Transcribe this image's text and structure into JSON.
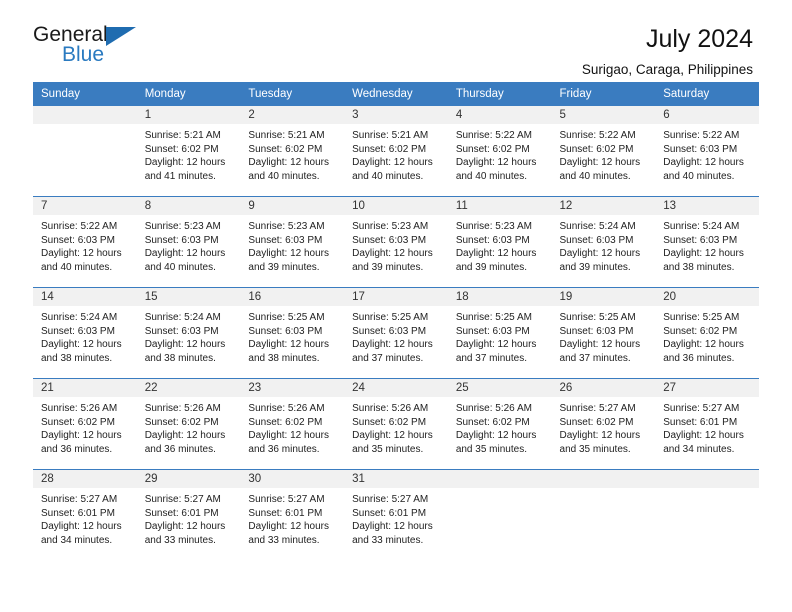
{
  "brand": {
    "name_top": "General",
    "name_bottom": "Blue",
    "triangle_color": "#1f6cb0",
    "blue_color": "#2a7ac0"
  },
  "header": {
    "title": "July 2024",
    "subtitle": "Surigao, Caraga, Philippines",
    "header_bg": "#3a7cc0",
    "daynum_bg": "#f1f1f1"
  },
  "weekdays": [
    "Sunday",
    "Monday",
    "Tuesday",
    "Wednesday",
    "Thursday",
    "Friday",
    "Saturday"
  ],
  "weeks": [
    [
      {
        "day": ""
      },
      {
        "day": "1",
        "sunrise": "Sunrise: 5:21 AM",
        "sunset": "Sunset: 6:02 PM",
        "daylight1": "Daylight: 12 hours",
        "daylight2": "and 41 minutes."
      },
      {
        "day": "2",
        "sunrise": "Sunrise: 5:21 AM",
        "sunset": "Sunset: 6:02 PM",
        "daylight1": "Daylight: 12 hours",
        "daylight2": "and 40 minutes."
      },
      {
        "day": "3",
        "sunrise": "Sunrise: 5:21 AM",
        "sunset": "Sunset: 6:02 PM",
        "daylight1": "Daylight: 12 hours",
        "daylight2": "and 40 minutes."
      },
      {
        "day": "4",
        "sunrise": "Sunrise: 5:22 AM",
        "sunset": "Sunset: 6:02 PM",
        "daylight1": "Daylight: 12 hours",
        "daylight2": "and 40 minutes."
      },
      {
        "day": "5",
        "sunrise": "Sunrise: 5:22 AM",
        "sunset": "Sunset: 6:02 PM",
        "daylight1": "Daylight: 12 hours",
        "daylight2": "and 40 minutes."
      },
      {
        "day": "6",
        "sunrise": "Sunrise: 5:22 AM",
        "sunset": "Sunset: 6:03 PM",
        "daylight1": "Daylight: 12 hours",
        "daylight2": "and 40 minutes."
      }
    ],
    [
      {
        "day": "7",
        "sunrise": "Sunrise: 5:22 AM",
        "sunset": "Sunset: 6:03 PM",
        "daylight1": "Daylight: 12 hours",
        "daylight2": "and 40 minutes."
      },
      {
        "day": "8",
        "sunrise": "Sunrise: 5:23 AM",
        "sunset": "Sunset: 6:03 PM",
        "daylight1": "Daylight: 12 hours",
        "daylight2": "and 40 minutes."
      },
      {
        "day": "9",
        "sunrise": "Sunrise: 5:23 AM",
        "sunset": "Sunset: 6:03 PM",
        "daylight1": "Daylight: 12 hours",
        "daylight2": "and 39 minutes."
      },
      {
        "day": "10",
        "sunrise": "Sunrise: 5:23 AM",
        "sunset": "Sunset: 6:03 PM",
        "daylight1": "Daylight: 12 hours",
        "daylight2": "and 39 minutes."
      },
      {
        "day": "11",
        "sunrise": "Sunrise: 5:23 AM",
        "sunset": "Sunset: 6:03 PM",
        "daylight1": "Daylight: 12 hours",
        "daylight2": "and 39 minutes."
      },
      {
        "day": "12",
        "sunrise": "Sunrise: 5:24 AM",
        "sunset": "Sunset: 6:03 PM",
        "daylight1": "Daylight: 12 hours",
        "daylight2": "and 39 minutes."
      },
      {
        "day": "13",
        "sunrise": "Sunrise: 5:24 AM",
        "sunset": "Sunset: 6:03 PM",
        "daylight1": "Daylight: 12 hours",
        "daylight2": "and 38 minutes."
      }
    ],
    [
      {
        "day": "14",
        "sunrise": "Sunrise: 5:24 AM",
        "sunset": "Sunset: 6:03 PM",
        "daylight1": "Daylight: 12 hours",
        "daylight2": "and 38 minutes."
      },
      {
        "day": "15",
        "sunrise": "Sunrise: 5:24 AM",
        "sunset": "Sunset: 6:03 PM",
        "daylight1": "Daylight: 12 hours",
        "daylight2": "and 38 minutes."
      },
      {
        "day": "16",
        "sunrise": "Sunrise: 5:25 AM",
        "sunset": "Sunset: 6:03 PM",
        "daylight1": "Daylight: 12 hours",
        "daylight2": "and 38 minutes."
      },
      {
        "day": "17",
        "sunrise": "Sunrise: 5:25 AM",
        "sunset": "Sunset: 6:03 PM",
        "daylight1": "Daylight: 12 hours",
        "daylight2": "and 37 minutes."
      },
      {
        "day": "18",
        "sunrise": "Sunrise: 5:25 AM",
        "sunset": "Sunset: 6:03 PM",
        "daylight1": "Daylight: 12 hours",
        "daylight2": "and 37 minutes."
      },
      {
        "day": "19",
        "sunrise": "Sunrise: 5:25 AM",
        "sunset": "Sunset: 6:03 PM",
        "daylight1": "Daylight: 12 hours",
        "daylight2": "and 37 minutes."
      },
      {
        "day": "20",
        "sunrise": "Sunrise: 5:25 AM",
        "sunset": "Sunset: 6:02 PM",
        "daylight1": "Daylight: 12 hours",
        "daylight2": "and 36 minutes."
      }
    ],
    [
      {
        "day": "21",
        "sunrise": "Sunrise: 5:26 AM",
        "sunset": "Sunset: 6:02 PM",
        "daylight1": "Daylight: 12 hours",
        "daylight2": "and 36 minutes."
      },
      {
        "day": "22",
        "sunrise": "Sunrise: 5:26 AM",
        "sunset": "Sunset: 6:02 PM",
        "daylight1": "Daylight: 12 hours",
        "daylight2": "and 36 minutes."
      },
      {
        "day": "23",
        "sunrise": "Sunrise: 5:26 AM",
        "sunset": "Sunset: 6:02 PM",
        "daylight1": "Daylight: 12 hours",
        "daylight2": "and 36 minutes."
      },
      {
        "day": "24",
        "sunrise": "Sunrise: 5:26 AM",
        "sunset": "Sunset: 6:02 PM",
        "daylight1": "Daylight: 12 hours",
        "daylight2": "and 35 minutes."
      },
      {
        "day": "25",
        "sunrise": "Sunrise: 5:26 AM",
        "sunset": "Sunset: 6:02 PM",
        "daylight1": "Daylight: 12 hours",
        "daylight2": "and 35 minutes."
      },
      {
        "day": "26",
        "sunrise": "Sunrise: 5:27 AM",
        "sunset": "Sunset: 6:02 PM",
        "daylight1": "Daylight: 12 hours",
        "daylight2": "and 35 minutes."
      },
      {
        "day": "27",
        "sunrise": "Sunrise: 5:27 AM",
        "sunset": "Sunset: 6:01 PM",
        "daylight1": "Daylight: 12 hours",
        "daylight2": "and 34 minutes."
      }
    ],
    [
      {
        "day": "28",
        "sunrise": "Sunrise: 5:27 AM",
        "sunset": "Sunset: 6:01 PM",
        "daylight1": "Daylight: 12 hours",
        "daylight2": "and 34 minutes."
      },
      {
        "day": "29",
        "sunrise": "Sunrise: 5:27 AM",
        "sunset": "Sunset: 6:01 PM",
        "daylight1": "Daylight: 12 hours",
        "daylight2": "and 33 minutes."
      },
      {
        "day": "30",
        "sunrise": "Sunrise: 5:27 AM",
        "sunset": "Sunset: 6:01 PM",
        "daylight1": "Daylight: 12 hours",
        "daylight2": "and 33 minutes."
      },
      {
        "day": "31",
        "sunrise": "Sunrise: 5:27 AM",
        "sunset": "Sunset: 6:01 PM",
        "daylight1": "Daylight: 12 hours",
        "daylight2": "and 33 minutes."
      },
      {
        "day": ""
      },
      {
        "day": ""
      },
      {
        "day": ""
      }
    ]
  ]
}
